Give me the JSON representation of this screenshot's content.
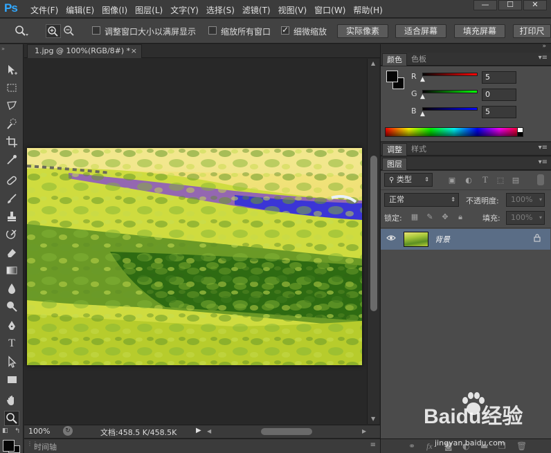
{
  "app": {
    "logo": "Ps"
  },
  "menu": [
    "文件(F)",
    "编辑(E)",
    "图像(I)",
    "图层(L)",
    "文字(Y)",
    "选择(S)",
    "滤镜(T)",
    "视图(V)",
    "窗口(W)",
    "帮助(H)"
  ],
  "window_controls": {
    "minimize": "—",
    "restore": "☐",
    "close": "✕"
  },
  "options": {
    "resize_windows_label": "调整窗口大小以满屏显示",
    "resize_windows_checked": false,
    "zoom_all_label": "缩放所有窗口",
    "zoom_all_checked": false,
    "scrubby_zoom_label": "细微缩放",
    "scrubby_zoom_checked": true,
    "actual_pixels": "实际像素",
    "fit_screen": "适合屏幕",
    "fill_screen": "填充屏幕",
    "print_size": "打印尺"
  },
  "document": {
    "tab_title": "1.jpg @ 100%(RGB/8#) *",
    "close": "×"
  },
  "status": {
    "zoom": "100%",
    "doc_size": "文档:458.5 K/458.5K"
  },
  "timeline": {
    "label": "时间轴"
  },
  "color_panel": {
    "tabs": [
      "颜色",
      "色板"
    ],
    "r_label": "R",
    "g_label": "G",
    "b_label": "B",
    "r": "5",
    "g": "0",
    "b": "5",
    "foreground": "#050505",
    "background": "#050505"
  },
  "adjust_panel": {
    "tabs": [
      "调整",
      "样式"
    ]
  },
  "layers_panel": {
    "tab": "图层",
    "filter_kind": "类型",
    "blend_mode": "正常",
    "opacity_label": "不透明度:",
    "opacity_value": "100%",
    "lock_label": "锁定:",
    "fill_label": "填充:",
    "fill_value": "100%",
    "layer_name": "背景"
  },
  "watermark": {
    "brand": "Baidu经验",
    "url": "jingyan.baidu.com"
  }
}
